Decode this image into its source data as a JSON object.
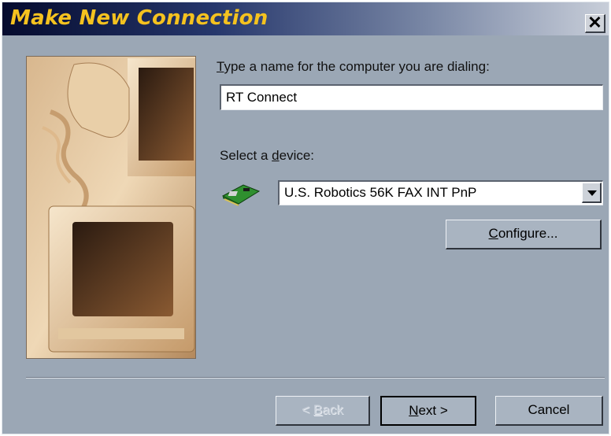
{
  "window": {
    "title": "Make New Connection",
    "close_label": "✕"
  },
  "form": {
    "name_prefix": "",
    "name_accel": "T",
    "name_label_rest": "ype a name for the computer you are dialing:",
    "name_value": "RT Connect",
    "device_label_prefix": "Select a ",
    "device_accel": "d",
    "device_label_rest": "evice:",
    "device_value": "U.S. Robotics 56K FAX INT PnP",
    "device_icon": "modem-icon"
  },
  "buttons": {
    "configure_accel": "C",
    "configure_rest": "onfigure...",
    "back_prefix": "< ",
    "back_accel": "B",
    "back_rest": "ack",
    "next_accel": "N",
    "next_rest": "ext >",
    "cancel_label": "Cancel"
  },
  "colors": {
    "title_text": "#f5c21f",
    "dialog_bg": "#9ba7b5",
    "titlebar_start": "#050b2e",
    "titlebar_end": "#c8ced9"
  }
}
